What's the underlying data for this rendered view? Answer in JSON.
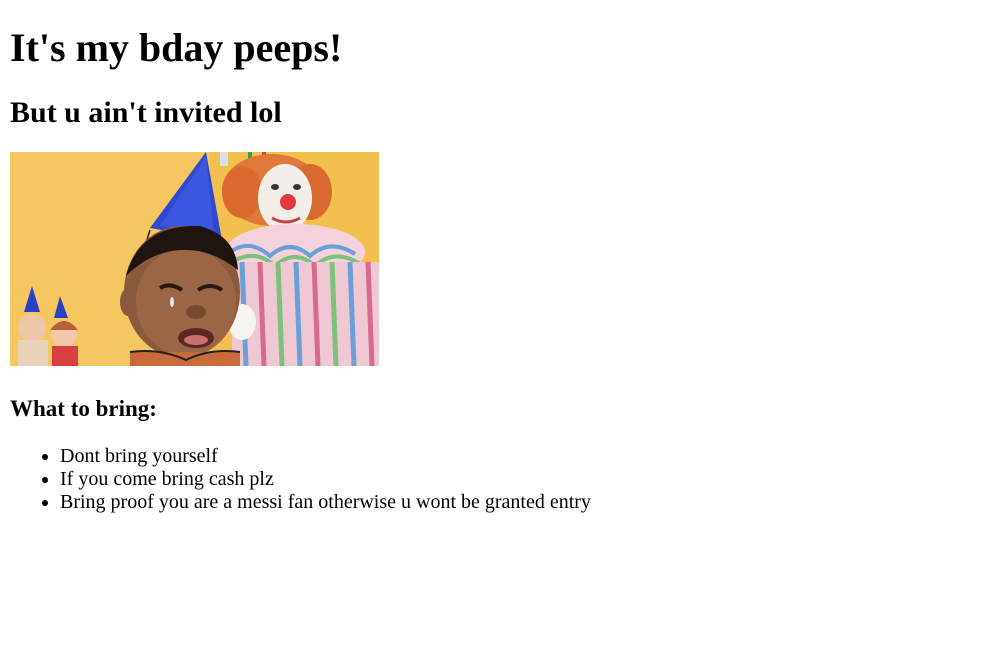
{
  "page": {
    "title": "It's my bday peeps!",
    "subtitle": "But u ain't invited lol"
  },
  "image": {
    "alt": "crying kid at party with clown"
  },
  "bring": {
    "heading": "What to bring:",
    "items": [
      "Dont bring yourself",
      "If you come bring cash plz",
      "Bring proof you are a messi fan otherwise u wont be granted entry"
    ]
  },
  "colors": {
    "background": "#ffffff",
    "text": "#000000",
    "wall_yellow": "#f2c04e",
    "party_hat_blue": "#2b3fc4"
  }
}
